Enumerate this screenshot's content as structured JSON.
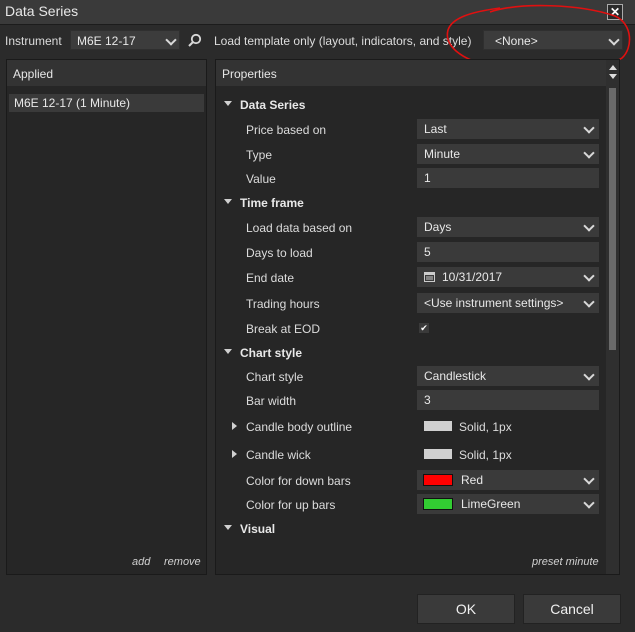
{
  "window": {
    "title": "Data Series"
  },
  "toolbar": {
    "instrument_label": "Instrument",
    "instrument_value": "M6E 12-17",
    "template_label": "Load template only (layout, indicators, and style)",
    "template_value": "<None>"
  },
  "applied": {
    "header": "Applied",
    "items": [
      "M6E 12-17 (1 Minute)"
    ],
    "add_label": "add",
    "remove_label": "remove"
  },
  "properties": {
    "header": "Properties",
    "preset_label": "preset minute",
    "sections": {
      "data_series": "Data Series",
      "time_frame": "Time frame",
      "chart_style": "Chart style",
      "visual": "Visual"
    },
    "rows": {
      "price_based_on": {
        "label": "Price based on",
        "value": "Last"
      },
      "type": {
        "label": "Type",
        "value": "Minute"
      },
      "value": {
        "label": "Value",
        "value": "1"
      },
      "load_data_based_on": {
        "label": "Load data based on",
        "value": "Days"
      },
      "days_to_load": {
        "label": "Days to load",
        "value": "5"
      },
      "end_date": {
        "label": "End date",
        "value": "10/31/2017"
      },
      "trading_hours": {
        "label": "Trading hours",
        "value": "<Use instrument settings>"
      },
      "break_at_eod": {
        "label": "Break at EOD",
        "value": "✔"
      },
      "chart_style": {
        "label": "Chart style",
        "value": "Candlestick"
      },
      "bar_width": {
        "label": "Bar width",
        "value": "3"
      },
      "candle_body_outline": {
        "label": "Candle body outline",
        "value": "Solid, 1px",
        "color": "#d0d0d0"
      },
      "candle_wick": {
        "label": "Candle wick",
        "value": "Solid, 1px",
        "color": "#d0d0d0"
      },
      "color_down": {
        "label": "Color for down bars",
        "value": "Red",
        "color": "#ff0000"
      },
      "color_up": {
        "label": "Color for up bars",
        "value": "LimeGreen",
        "color": "#32cd32"
      }
    }
  },
  "buttons": {
    "ok": "OK",
    "cancel": "Cancel"
  },
  "annotation": {
    "color": "#e01010"
  },
  "icons": [
    "close-icon",
    "search-icon",
    "chevron-down-icon",
    "calendar-icon",
    "check-icon",
    "expand-icon",
    "collapse-icon"
  ]
}
